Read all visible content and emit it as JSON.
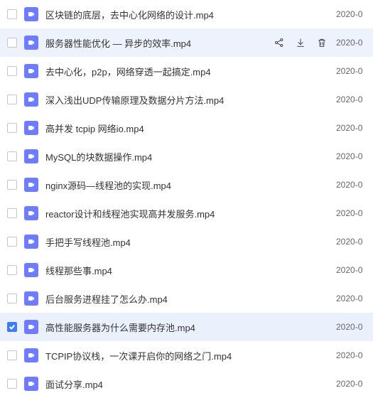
{
  "files": [
    {
      "name": "区块链的底层，去中心化网络的设计.mp4",
      "date": "2020-0",
      "hovered": false,
      "checked": false
    },
    {
      "name": "服务器性能优化 — 异步的效率.mp4",
      "date": "2020-0",
      "hovered": true,
      "checked": false
    },
    {
      "name": "去中心化，p2p，网络穿透一起搞定.mp4",
      "date": "2020-0",
      "hovered": false,
      "checked": false
    },
    {
      "name": "深入浅出UDP传输原理及数据分片方法.mp4",
      "date": "2020-0",
      "hovered": false,
      "checked": false
    },
    {
      "name": "高并发 tcpip 网络io.mp4",
      "date": "2020-0",
      "hovered": false,
      "checked": false
    },
    {
      "name": "MySQL的块数据操作.mp4",
      "date": "2020-0",
      "hovered": false,
      "checked": false
    },
    {
      "name": "nginx源码—线程池的实现.mp4",
      "date": "2020-0",
      "hovered": false,
      "checked": false
    },
    {
      "name": "reactor设计和线程池实现高并发服务.mp4",
      "date": "2020-0",
      "hovered": false,
      "checked": false
    },
    {
      "name": "手把手写线程池.mp4",
      "date": "2020-0",
      "hovered": false,
      "checked": false
    },
    {
      "name": "线程那些事.mp4",
      "date": "2020-0",
      "hovered": false,
      "checked": false
    },
    {
      "name": "后台服务进程挂了怎么办.mp4",
      "date": "2020-0",
      "hovered": false,
      "checked": false
    },
    {
      "name": "高性能服务器为什么需要内存池.mp4",
      "date": "2020-0",
      "hovered": false,
      "checked": true
    },
    {
      "name": "TCPIP协议栈，一次课开启你的网络之门.mp4",
      "date": "2020-0",
      "hovered": false,
      "checked": false
    },
    {
      "name": "面试分享.mp4",
      "date": "2020-0",
      "hovered": false,
      "checked": false
    }
  ]
}
